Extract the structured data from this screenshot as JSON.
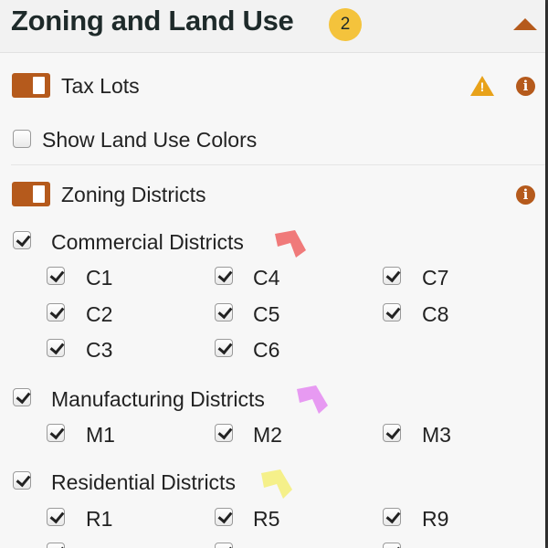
{
  "header": {
    "title": "Zoning and Land Use",
    "badge": "2"
  },
  "tax_lots": {
    "label": "Tax Lots",
    "toggle_on": true,
    "warning_icon": "warning-icon",
    "info_icon": "info-icon"
  },
  "land_use_colors": {
    "label": "Show Land Use Colors",
    "checked": false
  },
  "zoning_districts": {
    "label": "Zoning Districts",
    "toggle_on": true,
    "info_icon": "info-icon"
  },
  "groups": {
    "commercial": {
      "label": "Commercial Districts",
      "checked": true,
      "color": "#f07a7a",
      "items": [
        "C1",
        "C4",
        "C7",
        "C2",
        "C5",
        "C8",
        "C3",
        "C6"
      ]
    },
    "manufacturing": {
      "label": "Manufacturing Districts",
      "checked": true,
      "color": "#e79af2",
      "items": [
        "M1",
        "M2",
        "M3"
      ]
    },
    "residential": {
      "label": "Residential Districts",
      "checked": true,
      "color": "#f5f08a",
      "items": [
        "R1",
        "R5",
        "R9"
      ]
    }
  },
  "colors": {
    "accent": "#b55a1c",
    "badge": "#f4c33c",
    "warning": "#e8a21a"
  }
}
